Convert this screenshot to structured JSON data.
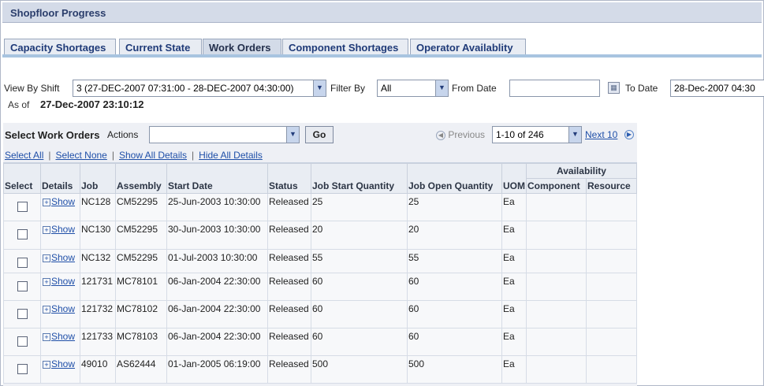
{
  "window": {
    "title": "Shopfloor Progress"
  },
  "tabs": [
    {
      "label": "Capacity Shortages"
    },
    {
      "label": "Current State"
    },
    {
      "label": "Work Orders"
    },
    {
      "label": "Component Shortages"
    },
    {
      "label": "Operator Availablity"
    }
  ],
  "filters": {
    "view_by_shift_label": "View By Shift",
    "view_by_shift_value": "3 (27-DEC-2007 07:31:00 - 28-DEC-2007 04:30:00)",
    "filter_by_label": "Filter By",
    "filter_by_value": "All",
    "from_date_label": "From Date",
    "from_date_value": "",
    "to_date_label": "To Date",
    "to_date_value": "28-Dec-2007 04:30",
    "as_of_label": "As of",
    "as_of_value": "27-Dec-2007 23:10:12"
  },
  "toolbar": {
    "heading": "Select Work Orders",
    "actions_label": "Actions",
    "actions_value": "",
    "go_label": "Go",
    "previous_label": "Previous",
    "range_value": "1-10 of 246",
    "next_label": "Next 10"
  },
  "links": {
    "select_all": "Select All",
    "select_none": "Select None",
    "show_all_details": "Show All Details",
    "hide_all_details": "Hide All Details"
  },
  "table": {
    "group_header": "Availability",
    "columns": [
      "Select",
      "Details",
      "Job",
      "Assembly",
      "Start Date",
      "Status",
      "Job Start Quantity",
      "Job Open Quantity",
      "UOM",
      "Component",
      "Resource"
    ],
    "show_label": "Show",
    "rows": [
      {
        "job": "NC128",
        "assembly": "CM52295",
        "start_date": "25-Jun-2003 10:30:00",
        "status": "Released",
        "start_qty": "25",
        "open_qty": "25",
        "uom": "Ea"
      },
      {
        "job": "NC130",
        "assembly": "CM52295",
        "start_date": "30-Jun-2003 10:30:00",
        "status": "Released",
        "start_qty": "20",
        "open_qty": "20",
        "uom": "Ea"
      },
      {
        "job": "NC132",
        "assembly": "CM52295",
        "start_date": "01-Jul-2003 10:30:00",
        "status": "Released",
        "start_qty": "55",
        "open_qty": "55",
        "uom": "Ea"
      },
      {
        "job": "121731",
        "assembly": "MC78101",
        "start_date": "06-Jan-2004 22:30:00",
        "status": "Released",
        "start_qty": "60",
        "open_qty": "60",
        "uom": "Ea"
      },
      {
        "job": "121732",
        "assembly": "MC78102",
        "start_date": "06-Jan-2004 22:30:00",
        "status": "Released",
        "start_qty": "60",
        "open_qty": "60",
        "uom": "Ea"
      },
      {
        "job": "121733",
        "assembly": "MC78103",
        "start_date": "06-Jan-2004 22:30:00",
        "status": "Released",
        "start_qty": "60",
        "open_qty": "60",
        "uom": "Ea"
      },
      {
        "job": "49010",
        "assembly": "AS62444",
        "start_date": "01-Jan-2005 06:19:00",
        "status": "Released",
        "start_qty": "500",
        "open_qty": "500",
        "uom": "Ea"
      }
    ]
  }
}
